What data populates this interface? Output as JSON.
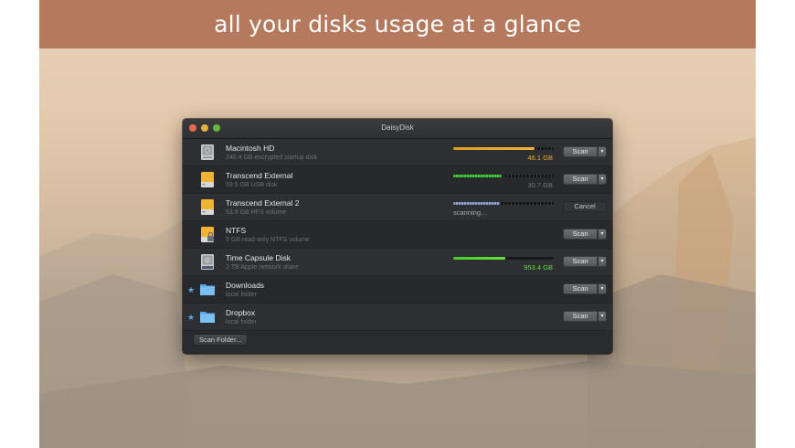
{
  "banner": {
    "text": "all your disks usage at a glance"
  },
  "window": {
    "title": "DaisyDisk"
  },
  "disks": [
    {
      "name": "Macintosh HD",
      "desc": "248.4 GB encrypted startup disk",
      "size": "46.1 GB",
      "fill_fraction": 0.81,
      "fill_color": "#f2a82a",
      "button": "Scan"
    },
    {
      "name": "Transcend External",
      "desc": "59.6 GB USB disk",
      "size": "30.7 GB",
      "fill_fraction": 0.48,
      "fill_color": "#3fcf3a",
      "button": "Scan"
    },
    {
      "name": "Transcend External 2",
      "desc": "53.9 GB HFS volume",
      "status": "scanning…",
      "fill_fraction": 0.46,
      "fill_color": "#8fa3c8",
      "button": "Cancel"
    },
    {
      "name": "NTFS",
      "desc": "5 GB read-only NTFS volume",
      "button": "Scan"
    },
    {
      "name": "Time Capsule Disk",
      "desc": "2 TB Apple network share",
      "size": "953.4 GB",
      "fill_fraction": 0.52,
      "fill_color": "#5ad834",
      "button": "Scan"
    },
    {
      "name": "Downloads",
      "desc": "local folder",
      "button": "Scan"
    },
    {
      "name": "Dropbox",
      "desc": "local folder",
      "button": "Scan"
    }
  ],
  "footer": {
    "scan_folder_label": "Scan Folder..."
  },
  "colors": {
    "banner": "#b57a5e",
    "window_bg": "#2a2b2e",
    "accent_blue": "#5fa6e8"
  }
}
